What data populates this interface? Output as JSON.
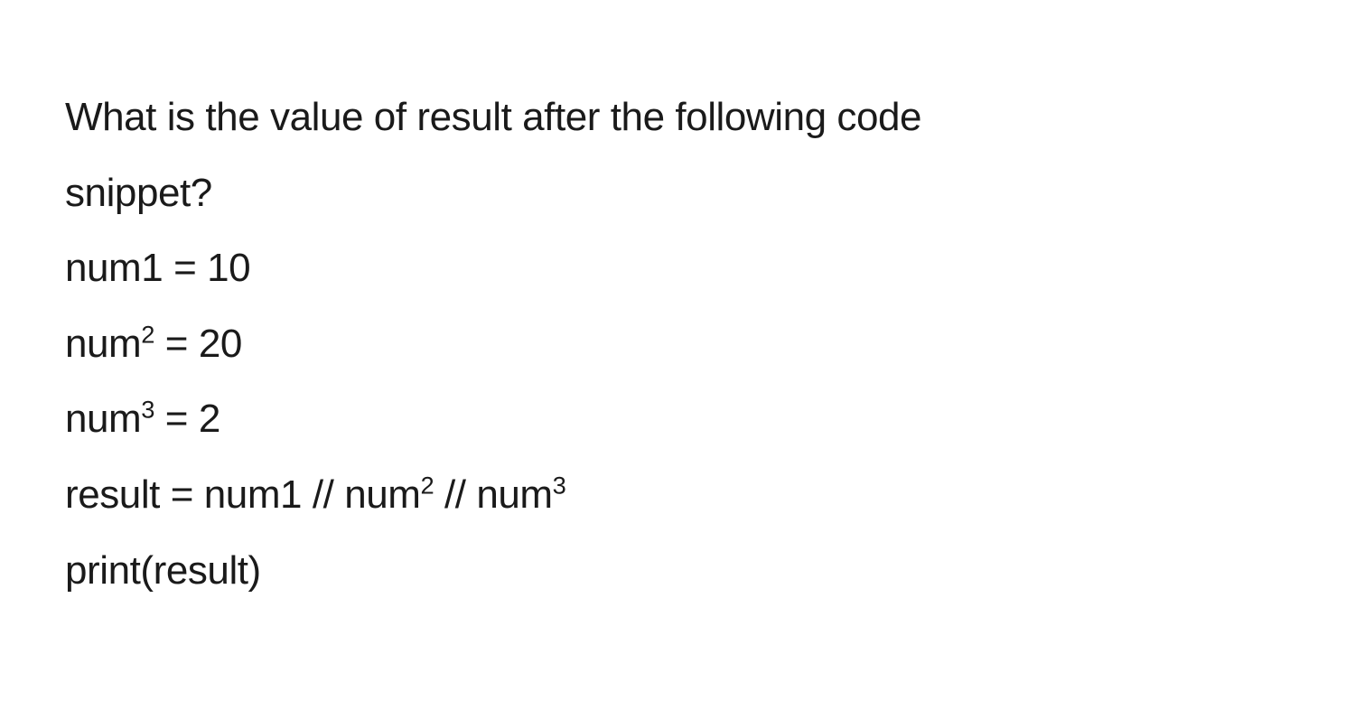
{
  "question": {
    "line1": "What is the value of result after the following code",
    "line2": "snippet?"
  },
  "code": {
    "l1_a": "num1 = 10",
    "l2_a": "num",
    "l2_sup": "2",
    "l2_b": " = 20",
    "l3_a": "num",
    "l3_sup": "3",
    "l3_b": " = 2",
    "l4_a": "result = num1 // num",
    "l4_sup1": "2",
    "l4_b": " // num",
    "l4_sup2": "3",
    "l5_a": "print(result)"
  }
}
